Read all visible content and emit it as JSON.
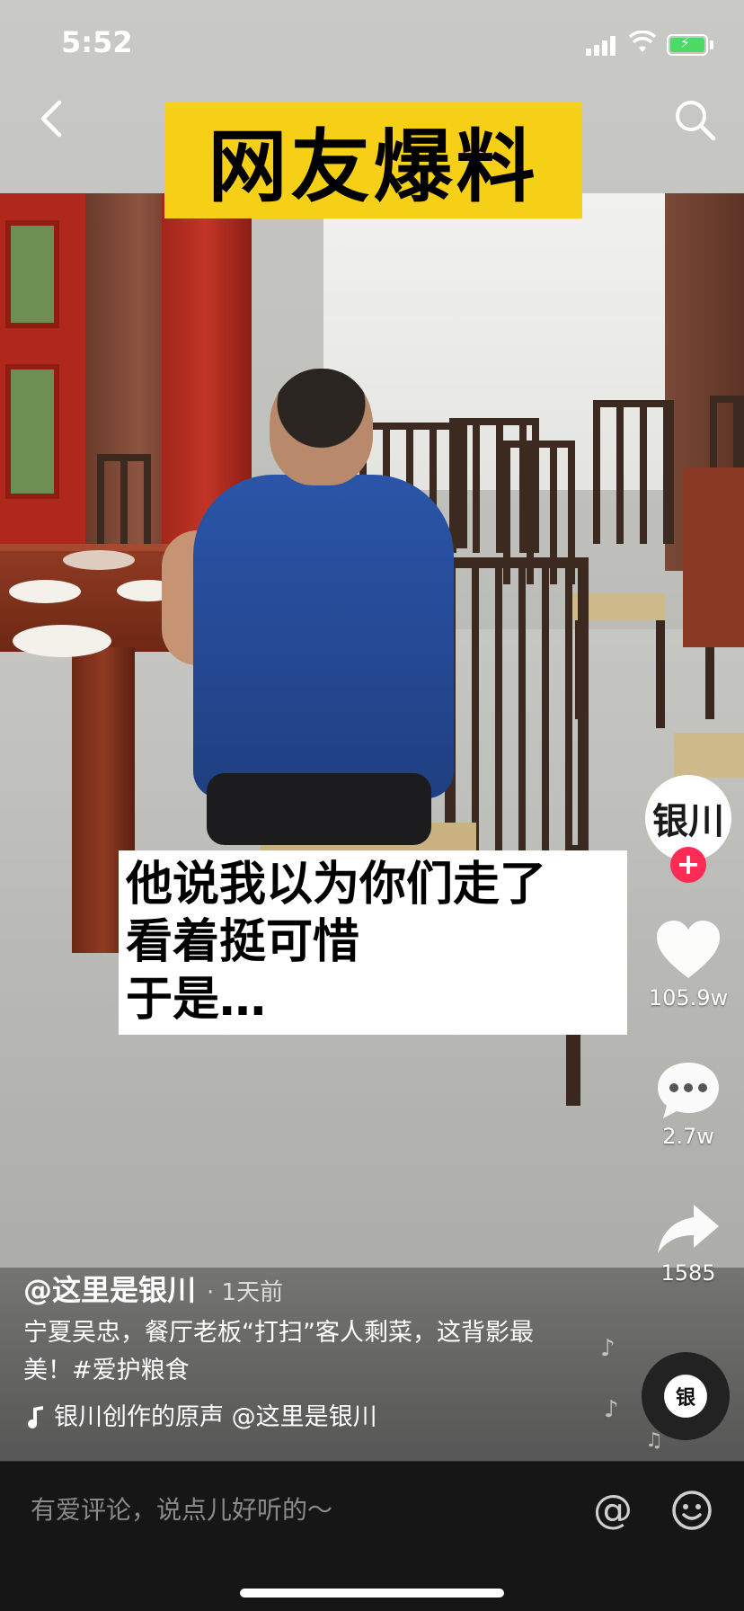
{
  "status_bar": {
    "time": "5:52"
  },
  "video": {
    "title_sticker": "网友爆料",
    "caption_lines": [
      "他说我以为你们走了",
      "看着挺可惜",
      "于是…"
    ]
  },
  "actions": {
    "likes": "105.9w",
    "comments": "2.7w",
    "shares": "1585"
  },
  "post": {
    "author": "@这里是银川",
    "time_ago": "· 1天前",
    "description": "宁夏吴忠，餐厅老板“打扫”客人剩菜，这背影最美！#爱护粮食",
    "music": "银川创作的原声    @这里是银川"
  },
  "comment_bar": {
    "placeholder": "有爱评论，说点儿好听的～"
  },
  "colors": {
    "title_sticker_bg": "#f5d016",
    "follow_plus": "#fe2c55",
    "battery": "#4cd964"
  },
  "icons": [
    "back-arrow-icon",
    "search-icon",
    "heart-icon",
    "comment-bubble-icon",
    "share-arrow-icon",
    "music-note-icon",
    "at-icon",
    "emoji-icon"
  ]
}
